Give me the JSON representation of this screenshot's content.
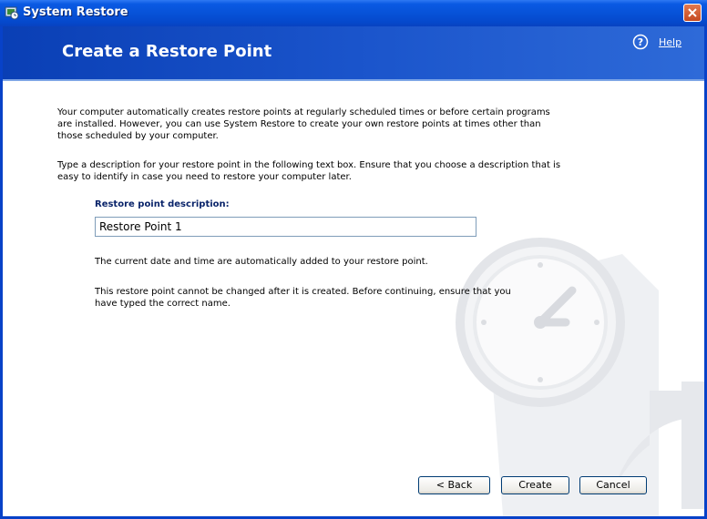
{
  "window": {
    "title": "System Restore"
  },
  "header": {
    "title": "Create a Restore Point",
    "help_label": "Help"
  },
  "body": {
    "paragraph1": "Your computer automatically creates restore points at regularly scheduled times or before certain programs are installed. However, you can use System Restore to create your own restore points at times other than those scheduled by your computer.",
    "paragraph2": "Type a description for your restore point in the following text box. Ensure that you choose a description that is easy to identify in case you need to restore your computer later.",
    "field_label": "Restore point description:",
    "field_value": "Restore Point 1",
    "note1": "The current date and time are automatically added to your restore point.",
    "note2": "This restore point cannot be changed after it is created. Before continuing, ensure that you have typed the correct name."
  },
  "buttons": {
    "back": "< Back",
    "create": "Create",
    "cancel": "Cancel"
  },
  "icons": {
    "app": "system-restore-icon",
    "close": "close-icon",
    "help": "help-icon"
  }
}
